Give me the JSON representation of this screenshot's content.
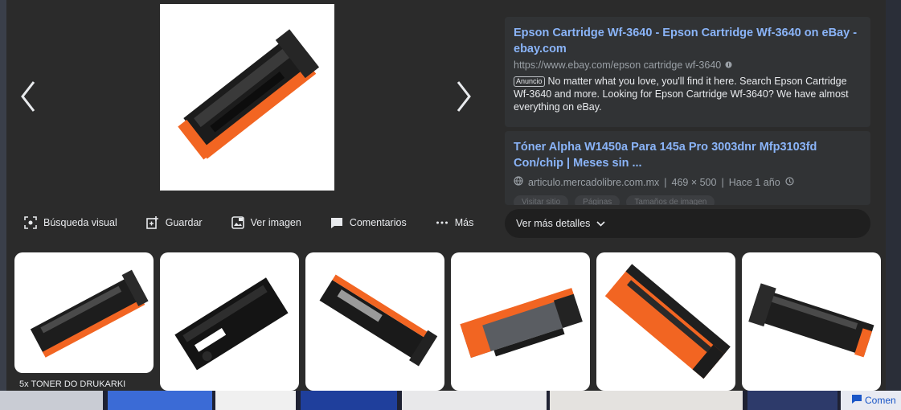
{
  "actions": [
    {
      "label": "Búsqueda visual",
      "icon": "visual-search-icon"
    },
    {
      "label": "Guardar",
      "icon": "save-icon"
    },
    {
      "label": "Ver imagen",
      "icon": "view-image-icon"
    },
    {
      "label": "Comentarios",
      "icon": "comment-icon"
    },
    {
      "label": "Más",
      "icon": "more-icon"
    }
  ],
  "results": [
    {
      "title": "Epson Cartridge Wf-3640 - Epson Cartridge Wf-3640 on eBay - ebay.com",
      "url": "https://www.ebay.com/epson cartridge wf-3640",
      "ad_label": "Anuncio",
      "description": "No matter what you love, you'll find it here. Search Epson Cartridge Wf-3640 and more. Looking for Epson Cartridge Wf-3640? We have almost everything on eBay."
    },
    {
      "title": "Tóner Alpha W1450a Para 145a Pro 3003dnr Mfp3103fd Con/chip | Meses sin ...",
      "domain": "articulo.mercadolibre.com.mx",
      "dimensions": "469 × 500",
      "age": "Hace 1 año",
      "buttons": [
        "Visitar sitio",
        "Páginas",
        "Tamaños de imagen"
      ]
    }
  ],
  "more_details": "Ver más detalles",
  "thumbnails": {
    "first_caption": "5x TONER DO DRUKARKI"
  },
  "bottom_right_label": "Comen",
  "colors": {
    "panel": "#2b2b2b",
    "card": "#313335",
    "link": "#8ab4f8",
    "toner_orange": "#f26522"
  }
}
